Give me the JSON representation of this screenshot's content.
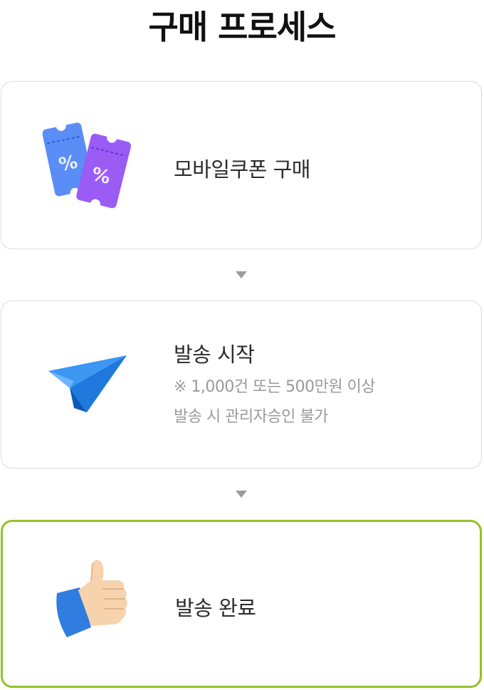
{
  "title": "구매 프로세스",
  "steps": [
    {
      "label": "모바일쿠폰 구매",
      "icon": "coupon-tickets-icon"
    },
    {
      "label": "발송 시작",
      "note_line1": "※ 1,000건 또는 500만원 이상",
      "note_line2": "발송 시 관리자승인 불가",
      "icon": "paper-plane-icon"
    },
    {
      "label": "발송 완료",
      "icon": "thumbs-up-icon"
    }
  ],
  "colors": {
    "active_border": "#93c22a",
    "card_border": "#dcdcdc",
    "arrow": "#9c9c9c"
  }
}
